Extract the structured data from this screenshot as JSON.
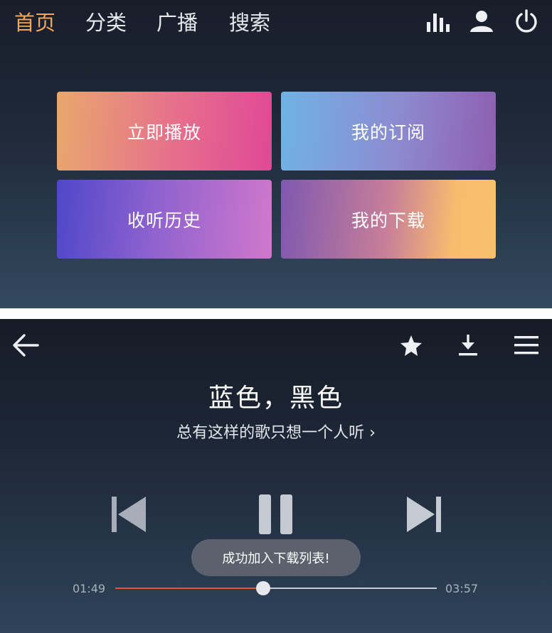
{
  "home": {
    "nav_tabs": [
      {
        "label": "首页",
        "active": true
      },
      {
        "label": "分类",
        "active": false
      },
      {
        "label": "广播",
        "active": false
      },
      {
        "label": "搜索",
        "active": false
      }
    ],
    "toolbar_icons": [
      "equalizer-icon",
      "user-icon",
      "power-icon"
    ],
    "tiles": [
      {
        "label": "立即播放"
      },
      {
        "label": "我的订阅"
      },
      {
        "label": "收听历史"
      },
      {
        "label": "我的下载"
      }
    ]
  },
  "player": {
    "toolbar_icons": [
      "back-arrow-icon",
      "star-icon",
      "download-icon",
      "menu-icon"
    ],
    "song_title": "蓝色，黑色",
    "playlist_link": "总有这样的歌只想一个人听 ›",
    "controls": [
      "previous-icon",
      "pause-icon",
      "next-icon"
    ],
    "toast": "成功加入下载列表!",
    "elapsed_time": "01:49",
    "total_time": "03:57",
    "progress_fraction": 0.46,
    "colors": {
      "progress_played": "#e9533a",
      "accent_tab": "#f3a55a"
    }
  }
}
